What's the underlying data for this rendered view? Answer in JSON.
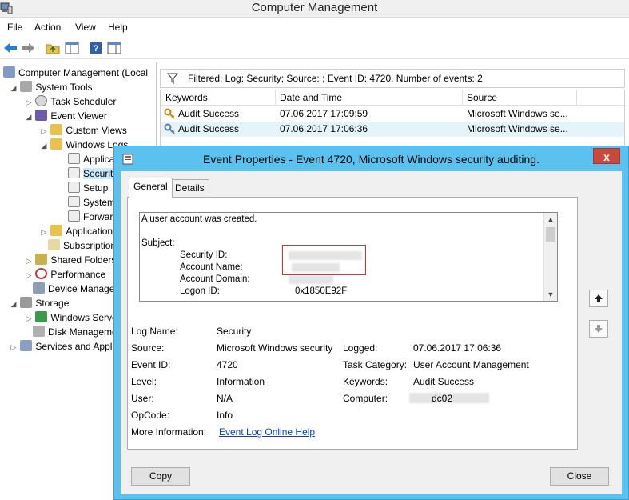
{
  "window": {
    "title": "Computer Management"
  },
  "menu": [
    "File",
    "Action",
    "View",
    "Help"
  ],
  "tree": [
    {
      "label": "Computer Management (Local",
      "expander": ""
    },
    {
      "label": "System Tools",
      "expander": "◢"
    },
    {
      "label": "Task Scheduler",
      "expander": "▷"
    },
    {
      "label": "Event Viewer",
      "expander": "◢"
    },
    {
      "label": "Custom Views",
      "expander": "▷"
    },
    {
      "label": "Windows Logs",
      "expander": "◢"
    },
    {
      "label": "Application",
      "expander": ""
    },
    {
      "label": "Security",
      "expander": ""
    },
    {
      "label": "Setup",
      "expander": ""
    },
    {
      "label": "System",
      "expander": ""
    },
    {
      "label": "Forwarded Events",
      "expander": ""
    },
    {
      "label": "Applications and Services Logs",
      "expander": "▷"
    },
    {
      "label": "Subscriptions",
      "expander": ""
    },
    {
      "label": "Shared Folders",
      "expander": "▷"
    },
    {
      "label": "Performance",
      "expander": "▷"
    },
    {
      "label": "Device Manager",
      "expander": ""
    },
    {
      "label": "Storage",
      "expander": "◢"
    },
    {
      "label": "Windows Server Backup",
      "expander": "▷"
    },
    {
      "label": "Disk Management",
      "expander": ""
    },
    {
      "label": "Services and Applications",
      "expander": "▷"
    }
  ],
  "filter": {
    "text": "Filtered: Log: Security; Source: ; Event ID: 4720. Number of events: 2"
  },
  "list": {
    "columns": [
      "Keywords",
      "Date and Time",
      "Source"
    ],
    "rows": [
      {
        "keyword": "Audit Success",
        "datetime": "07.06.2017 17:09:59",
        "source": "Microsoft Windows se..."
      },
      {
        "keyword": "Audit Success",
        "datetime": "07.06.2017 17:06:36",
        "source": "Microsoft Windows se..."
      }
    ]
  },
  "dialog": {
    "title": "Event Properties - Event 4720, Microsoft Windows security auditing.",
    "close": "x",
    "tabs": [
      "General",
      "Details"
    ],
    "description": {
      "line1": "A user account was created.",
      "subject": "Subject:",
      "security_id_label": "Security ID:",
      "account_name_label": "Account Name:",
      "account_domain_label": "Account Domain:",
      "logon_id_label": "Logon ID:",
      "logon_id_value": "0x1850E92F"
    },
    "fields": {
      "log_name_label": "Log Name:",
      "log_name": "Security",
      "source_label": "Source:",
      "source": "Microsoft Windows security",
      "logged_label": "Logged:",
      "logged": "07.06.2017 17:06:36",
      "event_id_label": "Event ID:",
      "event_id": "4720",
      "task_category_label": "Task Category:",
      "task_category": "User Account Management",
      "level_label": "Level:",
      "level": "Information",
      "keywords_label": "Keywords:",
      "keywords": "Audit Success",
      "user_label": "User:",
      "user": "N/A",
      "computer_label": "Computer:",
      "computer": "dc02",
      "opcode_label": "OpCode:",
      "opcode": "Info",
      "more_info_label": "More Information:",
      "more_info_link": "Event Log Online Help"
    },
    "buttons": {
      "copy": "Copy",
      "close": "Close"
    }
  }
}
